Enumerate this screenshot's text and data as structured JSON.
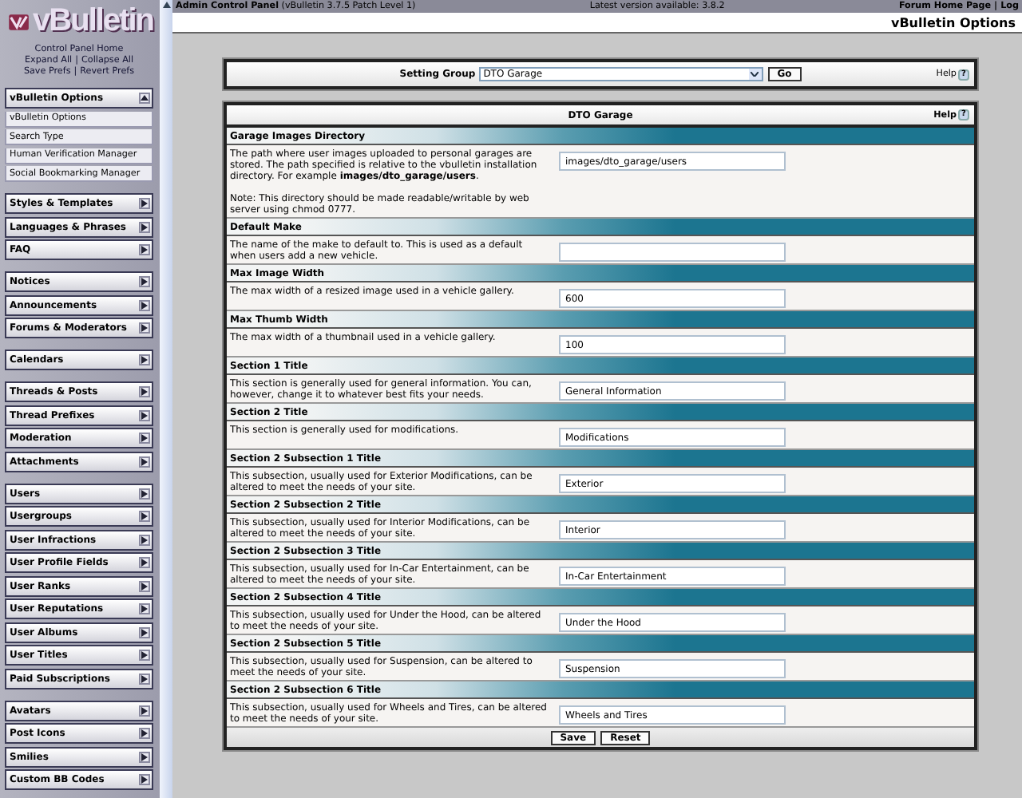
{
  "sidebar": {
    "logo": "vBulletin",
    "links": [
      [
        "Control Panel Home"
      ],
      [
        "Expand All",
        "Collapse All"
      ],
      [
        "Save Prefs",
        "Revert Prefs"
      ]
    ],
    "separator": "|",
    "groups": [
      [
        {
          "label": "vBulletin Options",
          "expanded": true,
          "children": [
            "vBulletin Options",
            "Search Type",
            "Human Verification Manager",
            "Social Bookmarking Manager"
          ]
        }
      ],
      [
        {
          "label": "Styles & Templates",
          "expanded": false
        },
        {
          "label": "Languages & Phrases",
          "expanded": false
        },
        {
          "label": "FAQ",
          "expanded": false
        }
      ],
      [
        {
          "label": "Notices",
          "expanded": false
        },
        {
          "label": "Announcements",
          "expanded": false
        },
        {
          "label": "Forums & Moderators",
          "expanded": false
        }
      ],
      [
        {
          "label": "Calendars",
          "expanded": false
        }
      ],
      [
        {
          "label": "Threads & Posts",
          "expanded": false
        },
        {
          "label": "Thread Prefixes",
          "expanded": false
        },
        {
          "label": "Moderation",
          "expanded": false
        },
        {
          "label": "Attachments",
          "expanded": false
        }
      ],
      [
        {
          "label": "Users",
          "expanded": false
        },
        {
          "label": "Usergroups",
          "expanded": false
        },
        {
          "label": "User Infractions",
          "expanded": false
        },
        {
          "label": "User Profile Fields",
          "expanded": false
        },
        {
          "label": "User Ranks",
          "expanded": false
        },
        {
          "label": "User Reputations",
          "expanded": false
        },
        {
          "label": "User Albums",
          "expanded": false
        },
        {
          "label": "User Titles",
          "expanded": false
        },
        {
          "label": "Paid Subscriptions",
          "expanded": false
        }
      ],
      [
        {
          "label": "Avatars",
          "expanded": false
        },
        {
          "label": "Post Icons",
          "expanded": false
        },
        {
          "label": "Smilies",
          "expanded": false
        },
        {
          "label": "Custom BB Codes",
          "expanded": false
        }
      ]
    ]
  },
  "top_bar": {
    "title": "**Admin Control Panel** (vBulletin 3.7.5 Patch Level 1)",
    "version": "Latest version available: 3.8.2",
    "links": [
      "Forum Home Page",
      "Log"
    ],
    "separator": "|"
  },
  "page_title": "vBulletin Options",
  "setting_group": {
    "label": "Setting Group",
    "value": "DTO Garage",
    "button": "Go",
    "help": "Help",
    "help_icon": "?"
  },
  "panel": {
    "title": "DTO Garage",
    "help": "Help",
    "help_icon": "?",
    "settings": [
      {
        "title": "Garage Images Directory",
        "description": "The path where user images uploaded to personal garages are stored. The path specified is relative to the vbulletin installation directory. For example **images/dto_garage/users**.",
        "note": "Note: This directory should be made readable/writable by web server using chmod 0777.",
        "value": "images/dto_garage/users"
      },
      {
        "title": "Default Make",
        "description": "The name of the make to default to. This is used as a default when users add a new vehicle."
      },
      {
        "title": "Max Image Width",
        "description": "The max width of a resized image used in a vehicle gallery.",
        "value": "600"
      },
      {
        "title": "Max Thumb Width",
        "description": "The max width of a thumbnail used in a vehicle gallery.",
        "value": "100"
      },
      {
        "title": "Section 1 Title",
        "description": "This section is generally used for general information. You can, however, change it to whatever best fits your needs.",
        "value": "General Information"
      },
      {
        "title": "Section 2 Title",
        "description": "This section is generally used for modifications.",
        "value": "Modifications"
      },
      {
        "title": "Section 2 Subsection 1 Title",
        "description": "This subsection, usually used for Exterior Modifications, can be altered to meet the needs of your site.",
        "value": "Exterior"
      },
      {
        "title": "Section 2 Subsection 2 Title",
        "description": "This subsection, usually used for Interior Modifications, can be altered to meet the needs of your site.",
        "value": "Interior"
      },
      {
        "title": "Section 2 Subsection 3 Title",
        "description": "This subsection, usually used for In-Car Entertainment, can be altered to meet the needs of your site.",
        "value": "In-Car Entertainment"
      },
      {
        "title": "Section 2 Subsection 4 Title",
        "description": "This subsection, usually used for Under the Hood, can be altered to meet the needs of your site.",
        "value": "Under the Hood"
      },
      {
        "title": "Section 2 Subsection 5 Title",
        "description": "This subsection, usually used for Suspension, can be altered to meet the needs of your site.",
        "value": "Suspension"
      },
      {
        "title": "Section 2 Subsection 6 Title",
        "description": "This subsection, usually used for Wheels and Tires, can be altered to meet the needs of your site.",
        "value": "Wheels and Tires"
      }
    ],
    "buttons": [
      "Save",
      "Reset"
    ]
  }
}
